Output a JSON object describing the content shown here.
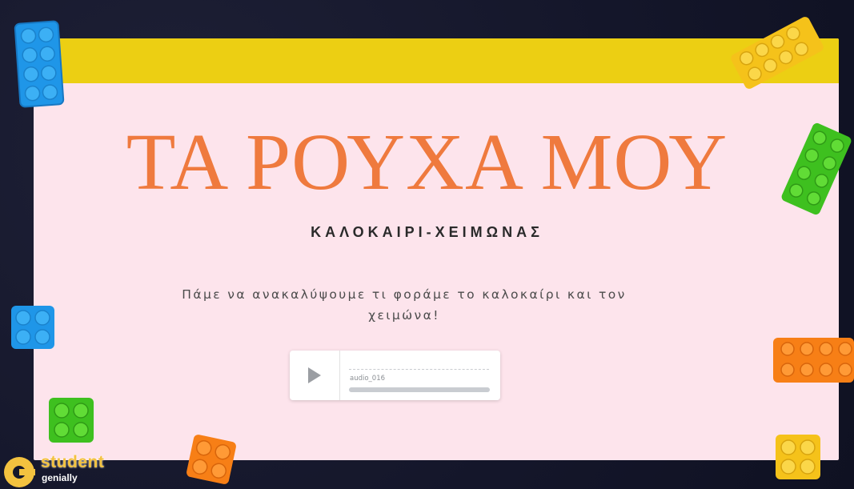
{
  "slide": {
    "title": "ΤΑ ΡΟΥΧΑ ΜΟΥ",
    "subtitle": "ΚΑΛΟΚΑΙΡΙ-ΧΕΙΜΩΝΑΣ",
    "description": "Πάμε να ανακαλύψουμε τι φοράμε το καλοκαίρι και τον χειμώνα!"
  },
  "audio_player": {
    "file_name": "audio_016",
    "progress": 0,
    "play_icon": "play-icon"
  },
  "branding": {
    "word": "student",
    "brand": "genially",
    "logo_icon": "genially-logo-icon"
  },
  "colors": {
    "banner": "#eccf13",
    "card_background": "#fde4ec",
    "title": "#ef7a3e",
    "page_background": "#15172a"
  },
  "decorations": [
    "blue-lego-brick",
    "yellow-lego-brick",
    "green-lego-brick",
    "blue-lego-brick",
    "orange-lego-brick",
    "green-lego-brick",
    "orange-lego-brick",
    "yellow-lego-brick"
  ]
}
